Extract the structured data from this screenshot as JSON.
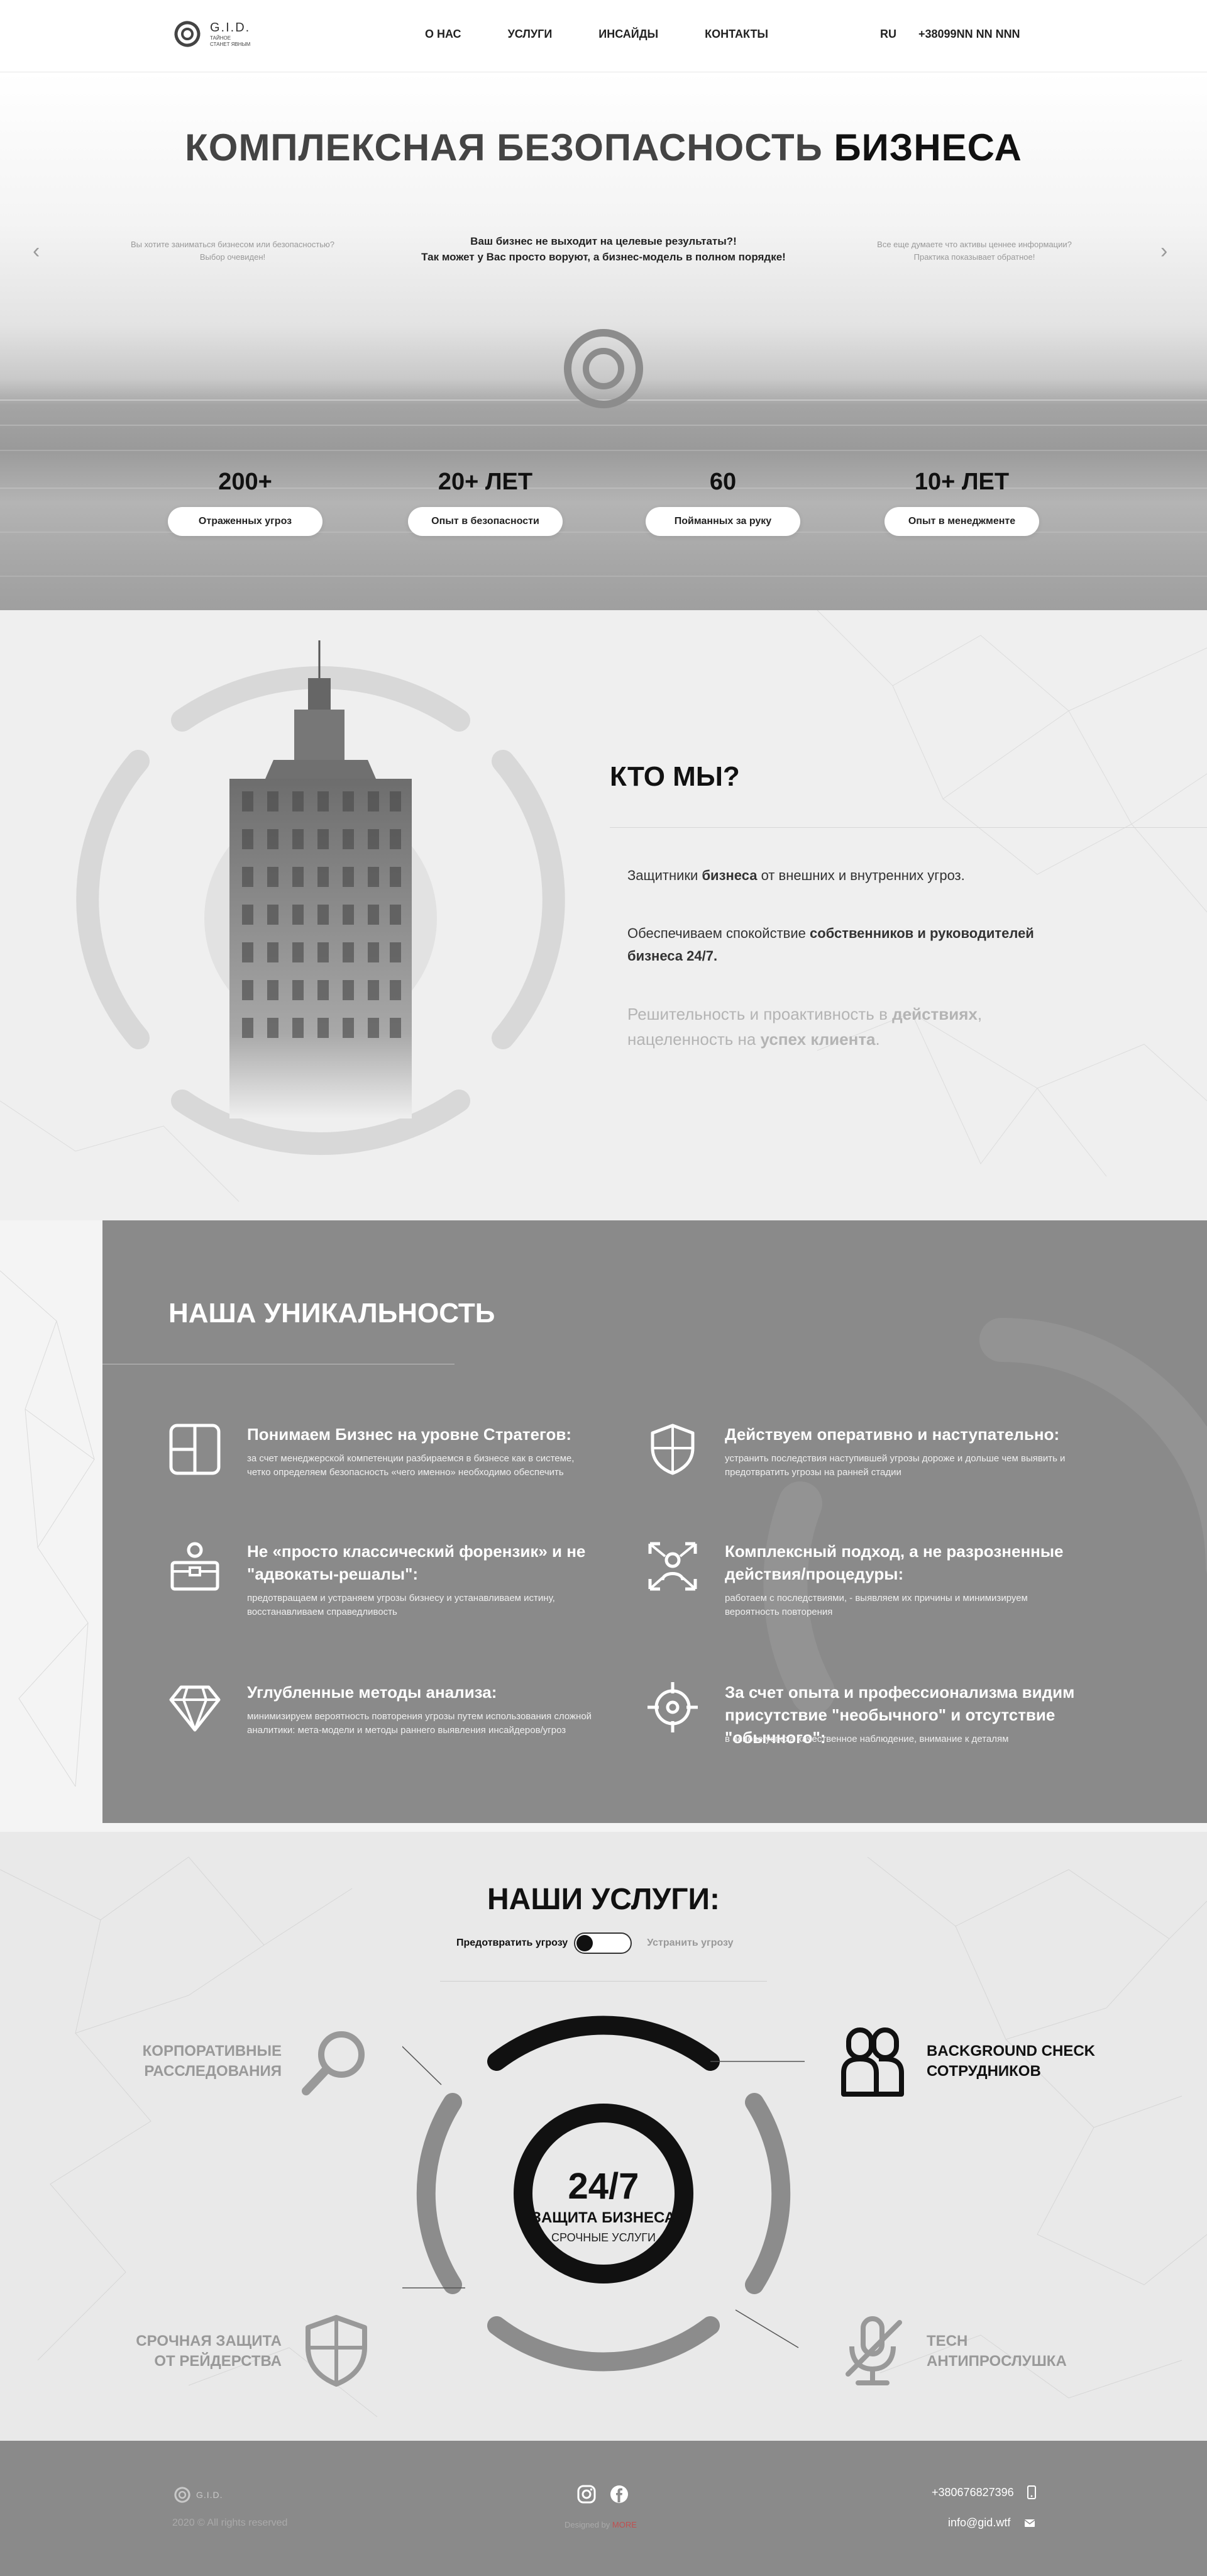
{
  "header": {
    "logo_text": "G.I.D.",
    "logo_tagline_1": "ТАЙНОЕ",
    "logo_tagline_2": "СТАНЕТ ЯВНЫМ",
    "nav": [
      "О НАС",
      "УСЛУГИ",
      "ИНСАЙДЫ",
      "КОНТАКТЫ"
    ],
    "lang": "RU",
    "phone": "+38099NN NN NNN"
  },
  "hero": {
    "title_light": "КОМПЛЕКСНАЯ БЕЗОПАСНОСТЬ",
    "title_bold": "БИЗНЕСА",
    "slide_prev": [
      "Вы хотите заниматься бизнесом или безопасностью?",
      "Выбор очевиден!"
    ],
    "slide_current": [
      "Ваш бизнес не выходит на целевые результаты?!",
      "Так может у Вас просто воруют, а бизнес-модель в полном порядке!"
    ],
    "slide_next": [
      "Все еще думаете что активы ценнее информации?",
      "Практика показывает обратное!"
    ],
    "prev_arrow": "‹",
    "next_arrow": "›",
    "stats": [
      {
        "value": "200+",
        "label": "Отраженных угроз"
      },
      {
        "value": "20+ ЛЕТ",
        "label": "Опыт в безопасности"
      },
      {
        "value": "60",
        "label": "Пойманных за руку"
      },
      {
        "value": "10+ ЛЕТ",
        "label": "Опыт в менеджменте"
      }
    ]
  },
  "who": {
    "title": "КТО МЫ?",
    "p1_a": "Защитники ",
    "p1_b": "бизнеса",
    "p1_c": " от внешних и внутренних угроз.",
    "p2_a": "Обеспечиваем спокойствие ",
    "p2_b": "собственников и руководителей бизнеса 24/7.",
    "p3_a": "Решительность  и проактивность в ",
    "p3_b": "действиях",
    "p3_c": ", нацеленность на ",
    "p3_d": "успех клиента",
    "p3_e": "."
  },
  "uniqueness": {
    "title": "НАША УНИКАЛЬНОСТЬ",
    "features": [
      {
        "icon": "layout-icon",
        "title": "Понимаем Бизнес на уровне Стратегов:",
        "text": "за счет менеджерской компетенции разбираемся в бизнесе как в системе, четко определяем безопасность «чего именно» необходимо обеспечить"
      },
      {
        "icon": "shield-icon",
        "title": "Действуем оперативно и наступательно:",
        "text": "устранить последствия наступившей угрозы дороже и дольше чем выявить и предотвратить угрозы на ранней стадии"
      },
      {
        "icon": "briefcase-person-icon",
        "title": "Не «просто классический форензик» и не \"адвокаты-решалы\":",
        "text": "предотвращаем и устраняем угрозы бизнесу и устанавливаем истину, восстанавливаем справедливость"
      },
      {
        "icon": "network-person-icon",
        "title": "Комплексный подход, а не разрозненные действия/процедуры:",
        "text": "работаем с последствиями, - выявляем их причины и минимизируем вероятность повторения"
      },
      {
        "icon": "diamond-icon",
        "title": "Углубленные методы анализа:",
        "text": "минимизируем вероятность повторения угрозы путем использования сложной аналитики: мета-модели и методы раннего выявления инсайдеров/угроз"
      },
      {
        "icon": "target-icon",
        "title": "За счет опыта и профессионализма видим присутствие \"необычного\" и отсутствие \"обычного\":",
        "text": "в основе успеха качественное наблюдение, внимание к деталям"
      }
    ]
  },
  "services": {
    "title": "НАШИ УСЛУГИ:",
    "toggle_on": "Предотвратить угрозу",
    "toggle_off": "Устранить угрозу",
    "items": [
      {
        "label_1": "КОРПОРАТИВНЫЕ",
        "label_2": "РАССЛЕДОВАНИЯ",
        "icon": "magnifier-icon"
      },
      {
        "label_1": "BACKGROUND CHECK",
        "label_2": "СОТРУДНИКОВ",
        "icon": "people-icon"
      },
      {
        "label_1": "СРОЧНАЯ ЗАЩИТА",
        "label_2": "ОТ РЕЙДЕРСТВА",
        "icon": "shield-icon"
      },
      {
        "label_1": "TECH",
        "label_2": "АНТИПРОСЛУШКА",
        "icon": "mic-off-icon"
      }
    ],
    "center_big": "24/7",
    "center_mid": "ЗАЩИТА БИЗНЕСА",
    "center_small": "СРОЧНЫЕ УСЛУГИ"
  },
  "footer": {
    "logo_text": "G.I.D.",
    "copyright": "2020 © All rights reserved",
    "designed_by": "Designed by",
    "designer": "MORE",
    "phone": "+380676827396",
    "email": "info@gid.wtf"
  }
}
